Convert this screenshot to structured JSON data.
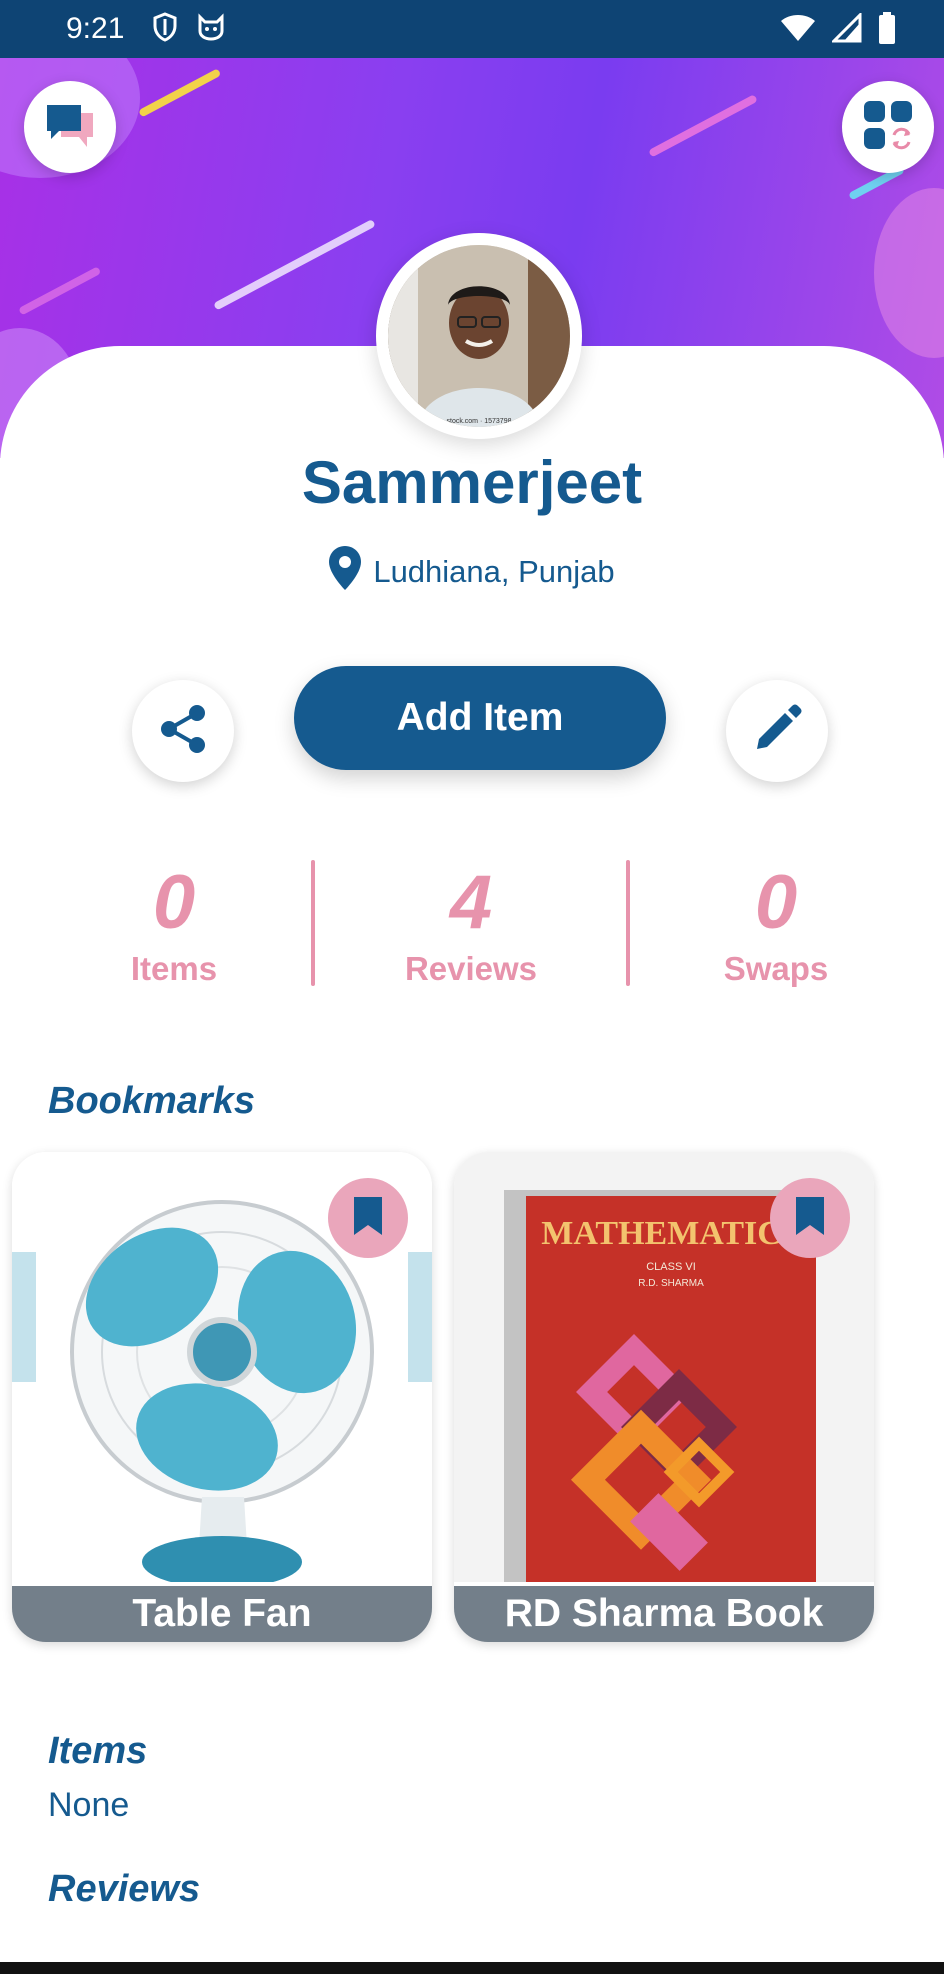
{
  "status_bar": {
    "time": "9:21",
    "left_icons": [
      "shield-icon",
      "cat-icon"
    ],
    "right_icons": [
      "wifi-icon",
      "signal-icon",
      "battery-icon"
    ]
  },
  "header": {
    "left_button_icon": "chat-bubbles-icon",
    "right_button_icon": "grid-swap-icon"
  },
  "profile": {
    "name": "Sammerjeet",
    "location": "Ludhiana, Punjab",
    "avatar_watermark": "...stock.com · 1573798..."
  },
  "actions": {
    "share_icon": "share-icon",
    "add_item_label": "Add Item",
    "edit_icon": "pencil-icon"
  },
  "stats": [
    {
      "value": "0",
      "label": "Items"
    },
    {
      "value": "4",
      "label": "Reviews"
    },
    {
      "value": "0",
      "label": "Swaps"
    }
  ],
  "bookmarks": {
    "title": "Bookmarks",
    "cards": [
      {
        "name": "Table Fan",
        "badge_icon": "bookmark-icon"
      },
      {
        "name": "RD Sharma Book",
        "badge_icon": "bookmark-icon",
        "book_title": "MATHEMATICS",
        "book_class": "CLASS VI",
        "book_author": "R.D. SHARMA"
      }
    ]
  },
  "items_section": {
    "title": "Items",
    "value": "None"
  },
  "reviews_section": {
    "title": "Reviews"
  },
  "colors": {
    "primary": "#155a8f",
    "accent_pink": "#e793ac",
    "status_bar": "#0e4474",
    "banner_purple": "#8a3ff0"
  }
}
